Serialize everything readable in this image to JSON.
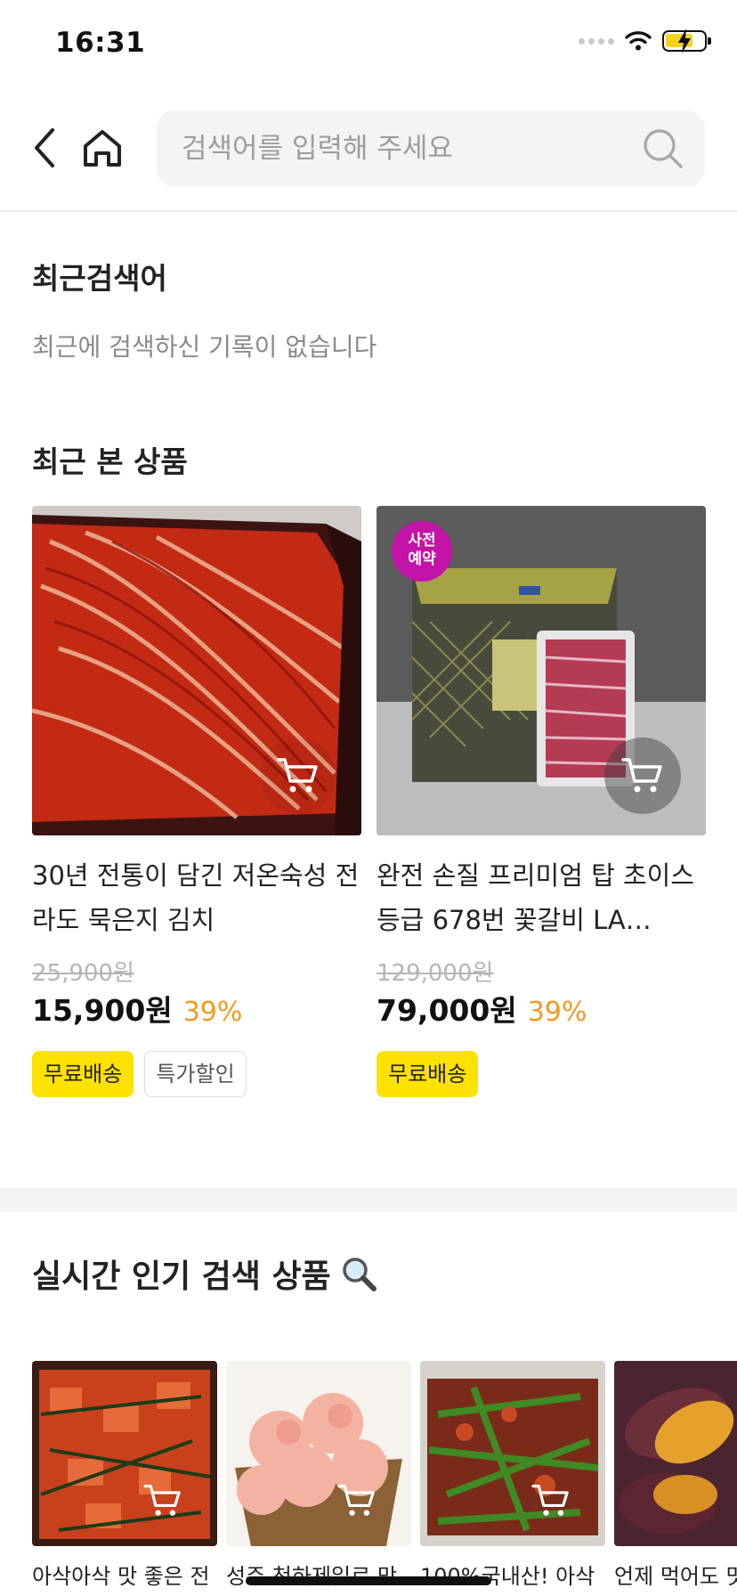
{
  "status_bar": {
    "time": "16:31"
  },
  "search": {
    "placeholder": "검색어를 입력해 주세요"
  },
  "recent_search": {
    "title": "최근검색어",
    "empty_message": "최근에 검색하신 기록이 없습니다"
  },
  "recently_viewed": {
    "title": "최근 본 상품",
    "items": [
      {
        "name": "30년 전통이 담긴 저온숙성 전라도 묵은지 김치",
        "original_price": "25,900원",
        "price": "15,900원",
        "discount": "39%",
        "tags": [
          "무료배송",
          "특가할인"
        ]
      },
      {
        "name": "완전 손질 프리미엄 탑 초이스 등급 678번 꽃갈비 LA…",
        "original_price": "129,000원",
        "price": "79,000원",
        "discount": "39%",
        "badge": "사전예약",
        "badge_lines": [
          "사전",
          "예약"
        ],
        "tags": [
          "무료배송"
        ]
      }
    ]
  },
  "popular": {
    "title": "실시간 인기 검색 상품",
    "title_icon": "magnifier-emoji",
    "items": [
      {
        "name": "아삭아삭 맛 좋은 전"
      },
      {
        "name": "성주 천하제일로 맛"
      },
      {
        "name": "100%국내산! 아삭"
      },
      {
        "name": "언제 먹어도 맛"
      }
    ]
  },
  "colors": {
    "accent_yellow": "#fde200",
    "discount_orange": "#f39a1e",
    "preorder_badge": "#c313a8"
  }
}
